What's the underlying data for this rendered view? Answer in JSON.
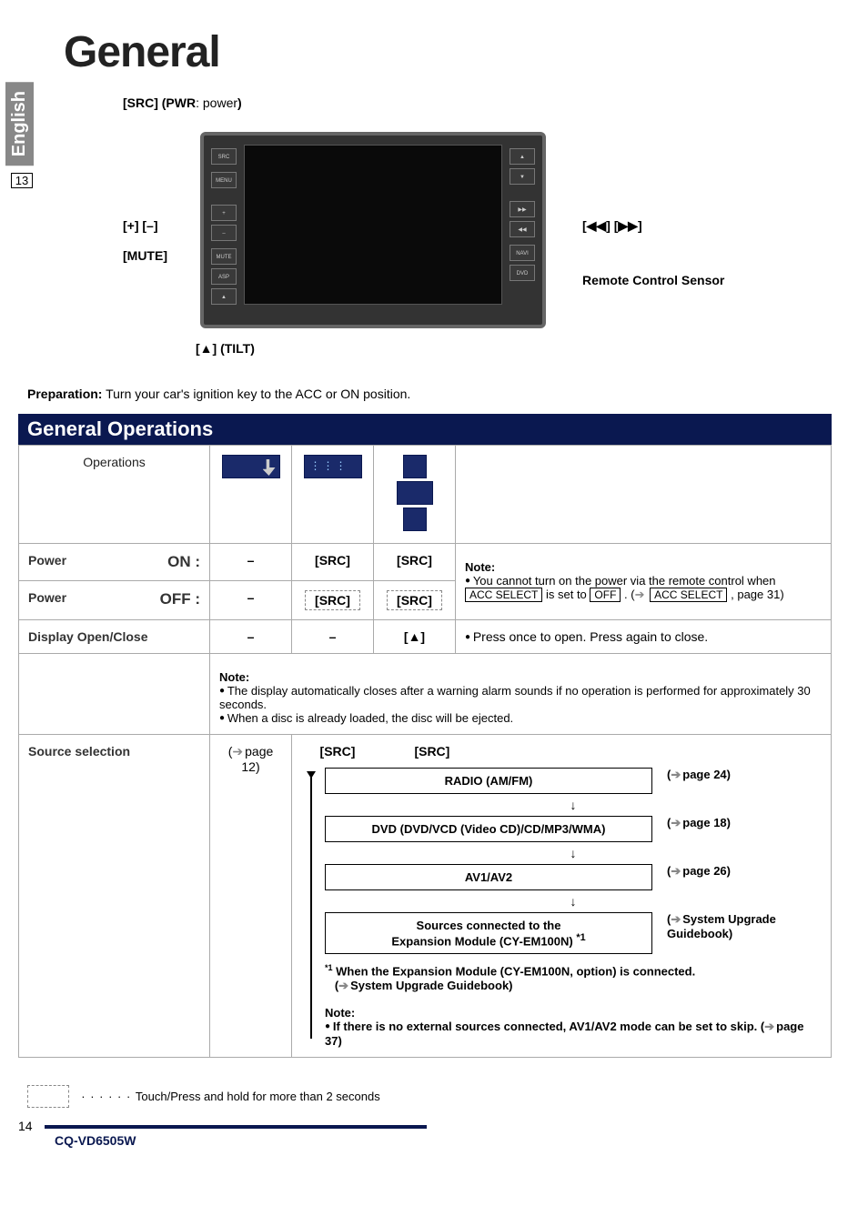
{
  "page": {
    "title": "General",
    "language": "English",
    "side_page_ref": "13",
    "model": "CQ-VD6505W",
    "page_number": "14"
  },
  "diagram": {
    "src_label_pre": "[SRC] (PWR",
    "src_label_mid": ": power",
    "src_label_post": ")",
    "plus_minus": "[+] [–]",
    "mute": "[MUTE]",
    "prev_next": "[◀◀] [▶▶]",
    "remote_sensor": "Remote Control Sensor",
    "tilt": "[▲] (TILT)"
  },
  "preparation": {
    "label": "Preparation:",
    "text": " Turn your car's ignition key to the ACC or ON position."
  },
  "section_header": "General Operations",
  "headers": {
    "operations": "Operations"
  },
  "rows": {
    "power_on": {
      "label": "Power",
      "sub": "ON :",
      "c1": "–",
      "c2": "[SRC]",
      "c3": "[SRC]"
    },
    "power_off": {
      "label": "Power",
      "sub": "OFF :",
      "c1": "–",
      "c2": "[SRC]",
      "c3": "[SRC]"
    },
    "power_note": {
      "note_label": "Note:",
      "bullet": "You cannot turn on the power via the remote control when ",
      "key1": "ACC SELECT",
      "mid": " is set to ",
      "key2": "OFF",
      "after": ". (",
      "key3": "ACC SELECT",
      "page_ref": ", page 31)"
    },
    "display": {
      "label": "Display Open/Close",
      "c1": "–",
      "c2": "–",
      "c3": "[▲] ",
      "desc": "Press once to open. Press again to close.",
      "note_label": "Note:",
      "bullet1": "The display automatically closes after a warning alarm sounds if no operation is performed for approximately 30 seconds.",
      "bullet2": "When a disc is already loaded, the disc will be ejected."
    },
    "source": {
      "label": "Source selection",
      "c1": "page 12)",
      "c2": "[SRC]",
      "c3": "[SRC]"
    }
  },
  "flow": {
    "radio": {
      "title": "RADIO",
      "sub": " (AM/FM)",
      "ref": "page 24)"
    },
    "dvd": {
      "title": "DVD",
      "sub": " (DVD/VCD (Video CD)/CD/MP3/WMA)",
      "ref": "page 18)"
    },
    "av": {
      "title": "AV1/AV2",
      "ref": "page 26)"
    },
    "exp": {
      "line1": "Sources connected to the",
      "line2": "Expansion Module (CY-EM100N) ",
      "sup": "*1",
      "ref1": "System Upgrade",
      "ref2": "Guidebook)"
    },
    "footnote_sup": "*1",
    "footnote_body": " When the Expansion Module (CY-EM100N, option) is connected.",
    "footnote_ref": "System Upgrade Guidebook)",
    "skip_label": "Note:",
    "skip_bullet_pre": "If there is no external sources connected, AV1/AV2 mode can be set to skip. (",
    "skip_page": "page 37)"
  },
  "legend": {
    "text": "Touch/Press and hold for more than 2 seconds"
  }
}
